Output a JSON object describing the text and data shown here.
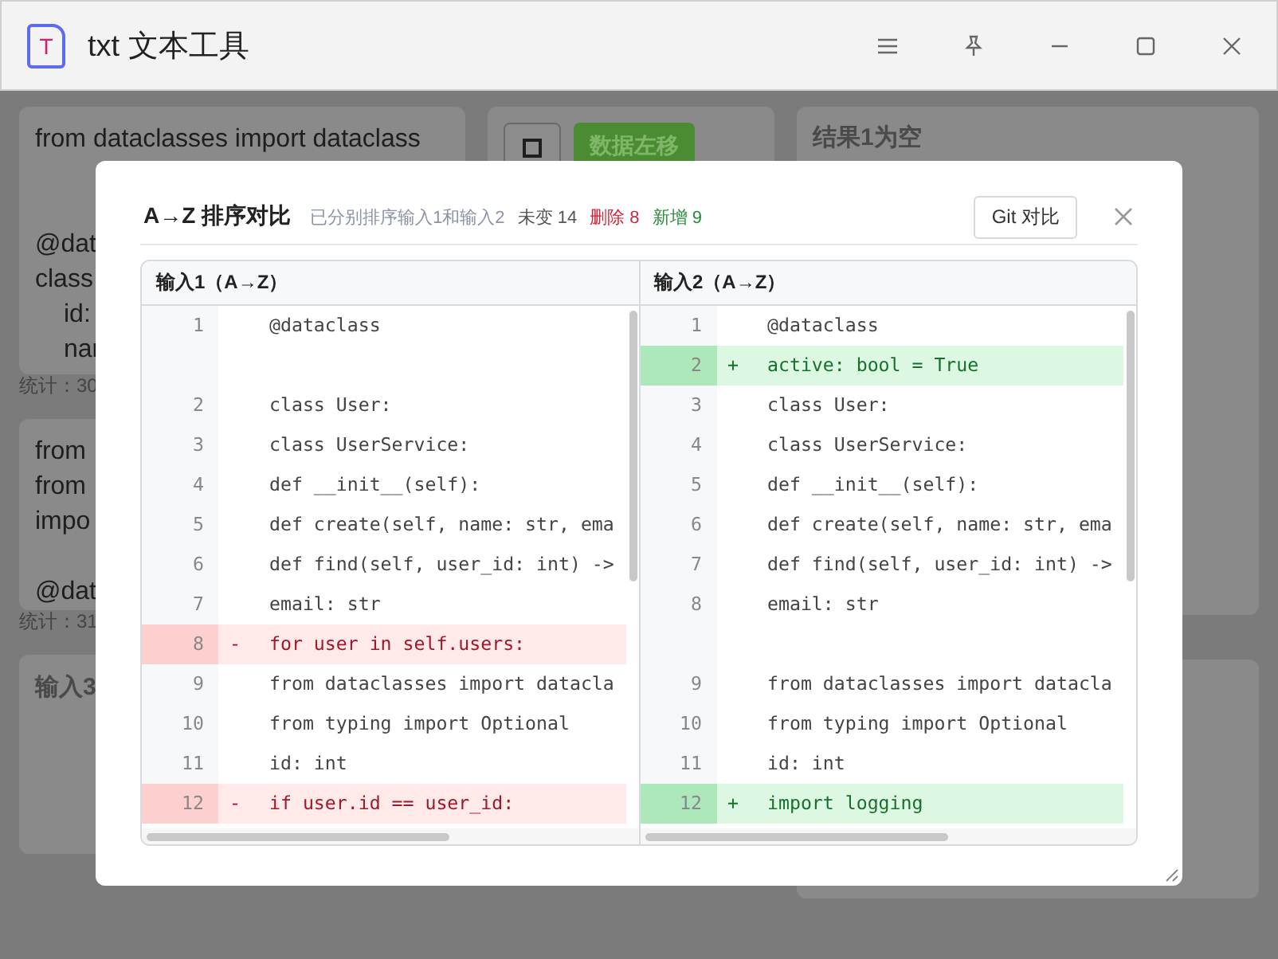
{
  "window": {
    "title": "txt 文本工具",
    "icon_letter": "T"
  },
  "background": {
    "left_panels": [
      {
        "lines": [
          "from dataclasses import dataclass"
        ],
        "side_lines": [
          "@dat",
          "class",
          "id:",
          "nar"
        ],
        "stats": "统计：30"
      },
      {
        "side_lines": [
          "from",
          "from",
          "impo",
          "@dat"
        ],
        "stats": "统计：31"
      },
      {
        "side_lines": [
          "输入3"
        ]
      }
    ],
    "middle_button": "数据左移",
    "right_title": "结果1为空"
  },
  "dialog": {
    "title": "A→Z 排序对比",
    "subtitle": "已分别排序输入1和输入2",
    "unchanged": "未变 14",
    "deleted": "删除 8",
    "added": "新增 9",
    "git_button": "Git 对比",
    "panes": [
      {
        "header": "输入1（A→Z）",
        "rows": [
          {
            "kind": "same",
            "num": "1",
            "text": "@dataclass"
          },
          {
            "kind": "blank"
          },
          {
            "kind": "same",
            "num": "2",
            "text": "class User:"
          },
          {
            "kind": "same",
            "num": "3",
            "text": "class UserService:"
          },
          {
            "kind": "same",
            "num": "4",
            "text": "def __init__(self):"
          },
          {
            "kind": "same",
            "num": "5",
            "text": "def create(self, name: str, ema"
          },
          {
            "kind": "same",
            "num": "6",
            "text": "def find(self, user_id: int) ->"
          },
          {
            "kind": "same",
            "num": "7",
            "text": "email: str"
          },
          {
            "kind": "del",
            "num": "8",
            "sign": "-",
            "text": "for user in self.users:"
          },
          {
            "kind": "same",
            "num": "9",
            "text": "from dataclasses import datacla"
          },
          {
            "kind": "same",
            "num": "10",
            "text": "from typing import Optional"
          },
          {
            "kind": "same",
            "num": "11",
            "text": "id: int"
          },
          {
            "kind": "del",
            "num": "12",
            "sign": "-",
            "text": "if user.id == user_id:"
          }
        ]
      },
      {
        "header": "输入2（A→Z）",
        "rows": [
          {
            "kind": "same",
            "num": "1",
            "text": "@dataclass"
          },
          {
            "kind": "add",
            "num": "2",
            "sign": "+",
            "text": "active: bool = True"
          },
          {
            "kind": "same",
            "num": "3",
            "text": "class User:"
          },
          {
            "kind": "same",
            "num": "4",
            "text": "class UserService:"
          },
          {
            "kind": "same",
            "num": "5",
            "text": "def __init__(self):"
          },
          {
            "kind": "same",
            "num": "6",
            "text": "def create(self, name: str, ema"
          },
          {
            "kind": "same",
            "num": "7",
            "text": "def find(self, user_id: int) ->"
          },
          {
            "kind": "same",
            "num": "8",
            "text": "email: str"
          },
          {
            "kind": "blank"
          },
          {
            "kind": "same",
            "num": "9",
            "text": "from dataclasses import datacla"
          },
          {
            "kind": "same",
            "num": "10",
            "text": "from typing import Optional"
          },
          {
            "kind": "same",
            "num": "11",
            "text": "id: int"
          },
          {
            "kind": "add",
            "num": "12",
            "sign": "+",
            "text": "import logging"
          }
        ]
      }
    ]
  }
}
